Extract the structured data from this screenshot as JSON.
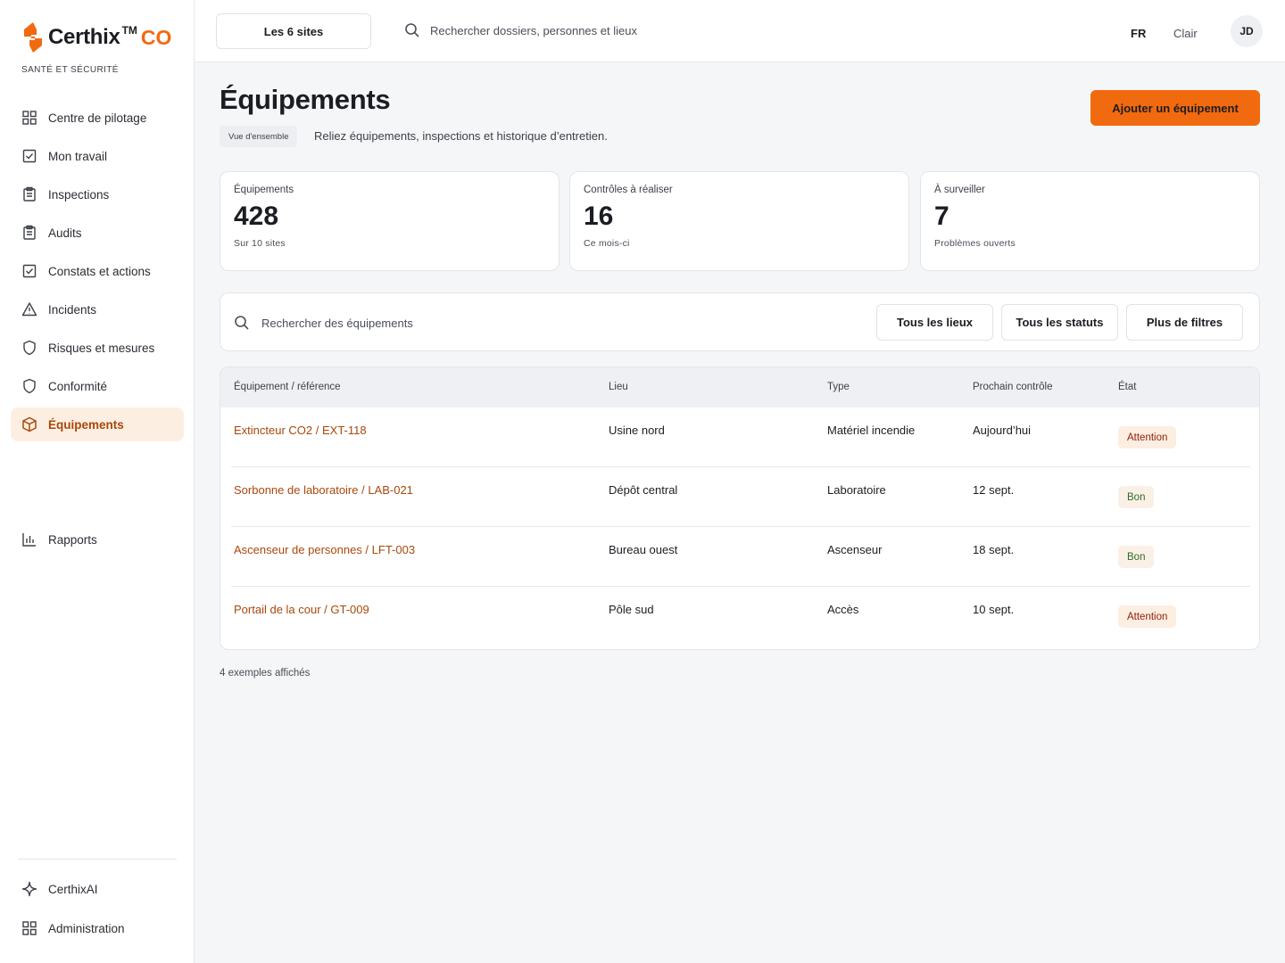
{
  "brand": {
    "name": "Certhix",
    "tm": "TM",
    "suffix": "CO",
    "tagline": "SANTÉ ET SÉCURITÉ"
  },
  "colors": {
    "accent": "#f26a0f",
    "active_bg": "#fdeee2",
    "active_text": "#a9470b"
  },
  "sidebar": {
    "items": [
      {
        "label": "Centre de pilotage",
        "icon": "grid-icon"
      },
      {
        "label": "Mon travail",
        "icon": "checkbox-icon"
      },
      {
        "label": "Inspections",
        "icon": "clipboard-icon"
      },
      {
        "label": "Audits",
        "icon": "clipboard-icon"
      },
      {
        "label": "Constats et actions",
        "icon": "checkbox-icon"
      },
      {
        "label": "Incidents",
        "icon": "warning-triangle-icon"
      },
      {
        "label": "Risques et mesures",
        "icon": "shield-icon"
      },
      {
        "label": "Conformité",
        "icon": "shield-icon"
      },
      {
        "label": "Équipements",
        "icon": "cube-icon",
        "active": true
      }
    ],
    "reports": {
      "label": "Rapports",
      "icon": "bar-chart-icon"
    },
    "bottom": [
      {
        "label": "CerthixAI",
        "icon": "sparkle-icon"
      },
      {
        "label": "Administration",
        "icon": "grid-icon"
      }
    ]
  },
  "topbar": {
    "site_selector": "Les 6 sites",
    "search_placeholder": "Rechercher dossiers, personnes et lieux",
    "language": "FR",
    "theme": "Clair",
    "avatar_initials": "JD"
  },
  "page": {
    "title": "Équipements",
    "crumb": "Vue d'ensemble",
    "subtitle": "Reliez équipements, inspections et historique d’entretien.",
    "add_button": "Ajouter un équipement"
  },
  "stats": [
    {
      "label": "Équipements",
      "value": "428",
      "sub": "Sur 10 sites"
    },
    {
      "label": "Contrôles à réaliser",
      "value": "16",
      "sub": "Ce mois-ci"
    },
    {
      "label": "À surveiller",
      "value": "7",
      "sub": "Problèmes ouverts"
    }
  ],
  "filters": {
    "search_placeholder": "Rechercher des équipements",
    "buttons": [
      "Tous les lieux",
      "Tous les statuts",
      "Plus de filtres"
    ]
  },
  "table": {
    "headers": [
      "Équipement / référence",
      "Lieu",
      "Type",
      "Prochain contrôle",
      "État"
    ],
    "rows": [
      {
        "equipment": "Extincteur CO2 / EXT-118",
        "location": "Usine nord",
        "type": "Matériel incendie",
        "next": "Aujourd’hui",
        "status": "Attention",
        "status_kind": "warn"
      },
      {
        "equipment": "Sorbonne de laboratoire / LAB-021",
        "location": "Dépôt central",
        "type": "Laboratoire",
        "next": "12 sept.",
        "status": "Bon",
        "status_kind": "ok"
      },
      {
        "equipment": "Ascenseur de personnes / LFT-003",
        "location": "Bureau ouest",
        "type": "Ascenseur",
        "next": "18 sept.",
        "status": "Bon",
        "status_kind": "ok"
      },
      {
        "equipment": "Portail de la cour / GT-009",
        "location": "Pôle sud",
        "type": "Accès",
        "next": "10 sept.",
        "status": "Attention",
        "status_kind": "warn"
      }
    ]
  },
  "footnote": "4 exemples affichés"
}
